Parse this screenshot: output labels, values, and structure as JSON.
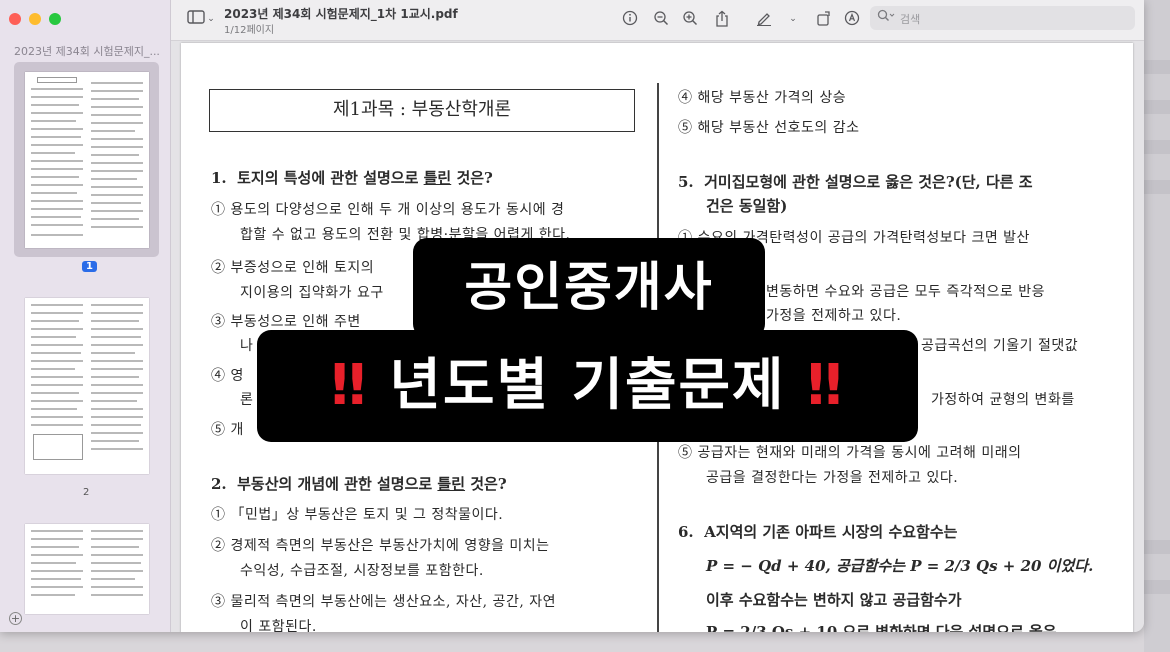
{
  "window": {
    "title": "2023년 제34회 시험문제지_1차 1교시.pdf",
    "subtitle": "1/12페이지"
  },
  "sidebar": {
    "title": "2023년 제34회 시험문제지_...",
    "pages": [
      {
        "number": "1",
        "selected": true
      },
      {
        "number": "2",
        "selected": false
      }
    ]
  },
  "toolbar": {
    "search_placeholder": "검색",
    "icons": [
      "sidebar-icon",
      "chevron-down-icon",
      "info-icon",
      "zoom-out-icon",
      "zoom-in-icon",
      "share-icon",
      "markup-pen-icon",
      "chevron-down-icon",
      "rotate-icon",
      "annotate-icon",
      "search-icon"
    ]
  },
  "document": {
    "subject": "제1과목 : 부동산학개론",
    "left": {
      "q1": {
        "number": "1.",
        "text_pre": "토지의 특성에 관한 설명으로 ",
        "text_u": "틀린",
        "text_post": " 것은?",
        "options": [
          "① 용도의 다양성으로 인해 두 개 이상의 용도가 동시에 경",
          "합할 수 없고 용도의 전환 및 합병·분할을 어렵게 한다.",
          "② 부증성으로 인해 토지의",
          "지이용의 집약화가 요구",
          "③ 부동성으로 인해 주변",
          "나",
          "④ 영",
          "론",
          "⑤ 개"
        ]
      },
      "q2": {
        "number": "2.",
        "text_pre": "부동산의 개념에 관한 설명으로 ",
        "text_u": "틀린",
        "text_post": " 것은?",
        "options": [
          "① 「민법」상 부동산은 토지 및 그 정착물이다.",
          "② 경제적 측면의 부동산은 부동산가치에 영향을 미치는",
          "수익성, 수급조절, 시장정보를 포함한다.",
          "③ 물리적 측면의 부동산에는 생산요소, 자산, 공간, 자연",
          "이 포함된다."
        ]
      }
    },
    "right": {
      "options_prev": [
        "④ 해당 부동산 가격의 상승",
        "⑤ 해당 부동산 선호도의 감소"
      ],
      "q5": {
        "number": "5.",
        "line1": "거미집모형에 관한 설명으로 옳은 것은?(단, 다른 조",
        "line2": "건은 동일함)",
        "options": [
          "① 수요의 가격탄력성이 공급의 가격탄력성보다 크면 발산",
          "변동하면 수요와 공급은 모두 즉각적으로 반응",
          "가정을 전제하고 있다.",
          "공급곡선의 기울기 절댓값",
          "가정하여 균형의 변화를",
          "⑤ 공급자는 현재와 미래의 가격을 동시에 고려해 미래의",
          "공급을 결정한다는 가정을 전제하고 있다."
        ]
      },
      "q6": {
        "number": "6.",
        "line1": "A지역의  기존  아파트  시장의  수요함수는",
        "line2": "P = − Qd + 40,  공급함수는  P = 2/3 Qs + 20  이었다.",
        "line3": "이후  수요함수는  변하지  않고  공급함수가",
        "line4": "P = 2/3 Qs + 10 으로 변화하면 다음 설명으로 옳은"
      }
    }
  },
  "overlay": {
    "line1": "공인중개사",
    "line2": "년도별 기출문제",
    "mark": "‼"
  }
}
